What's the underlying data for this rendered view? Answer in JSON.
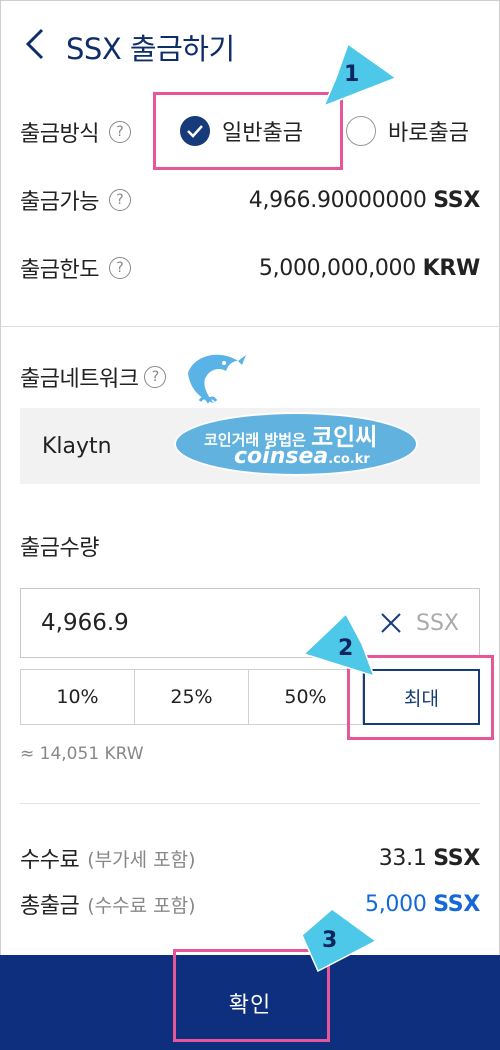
{
  "header": {
    "title": "SSX 출금하기"
  },
  "method": {
    "label": "출금방식",
    "options": [
      {
        "label": "일반출금",
        "selected": true
      },
      {
        "label": "바로출금",
        "selected": false
      }
    ]
  },
  "available": {
    "label": "출금가능",
    "value": "4,966.90000000",
    "unit": "SSX"
  },
  "limit": {
    "label": "출금한도",
    "value": "5,000,000,000",
    "unit": "KRW"
  },
  "network": {
    "label": "출금네트워크",
    "value": "Klaytn"
  },
  "amount": {
    "label": "출금수량",
    "value": "4,966.9",
    "unit": "SSX",
    "percent_buttons": [
      "10%",
      "25%",
      "50%",
      "최대"
    ],
    "krw_estimate": "≈ 14,051 KRW"
  },
  "fee": {
    "label": "수수료",
    "sub": "(부가세 포함)",
    "value": "33.1",
    "unit": "SSX"
  },
  "total": {
    "label": "총출금",
    "sub": "(수수료 포함)",
    "value": "5,000",
    "unit": "SSX",
    "color": "#1468d7"
  },
  "confirm": {
    "label": "확인"
  },
  "callouts": [
    "1",
    "2",
    "3"
  ],
  "watermark": {
    "line1_small": "코인거래 방법은",
    "line1_big": "코인씨",
    "line2": "coinsea",
    "line2_suffix": ".co.kr"
  },
  "colors": {
    "brand_navy": "#0e2f7d",
    "highlight_pink": "#e8569a",
    "callout_cyan": "#4dc8e8"
  }
}
